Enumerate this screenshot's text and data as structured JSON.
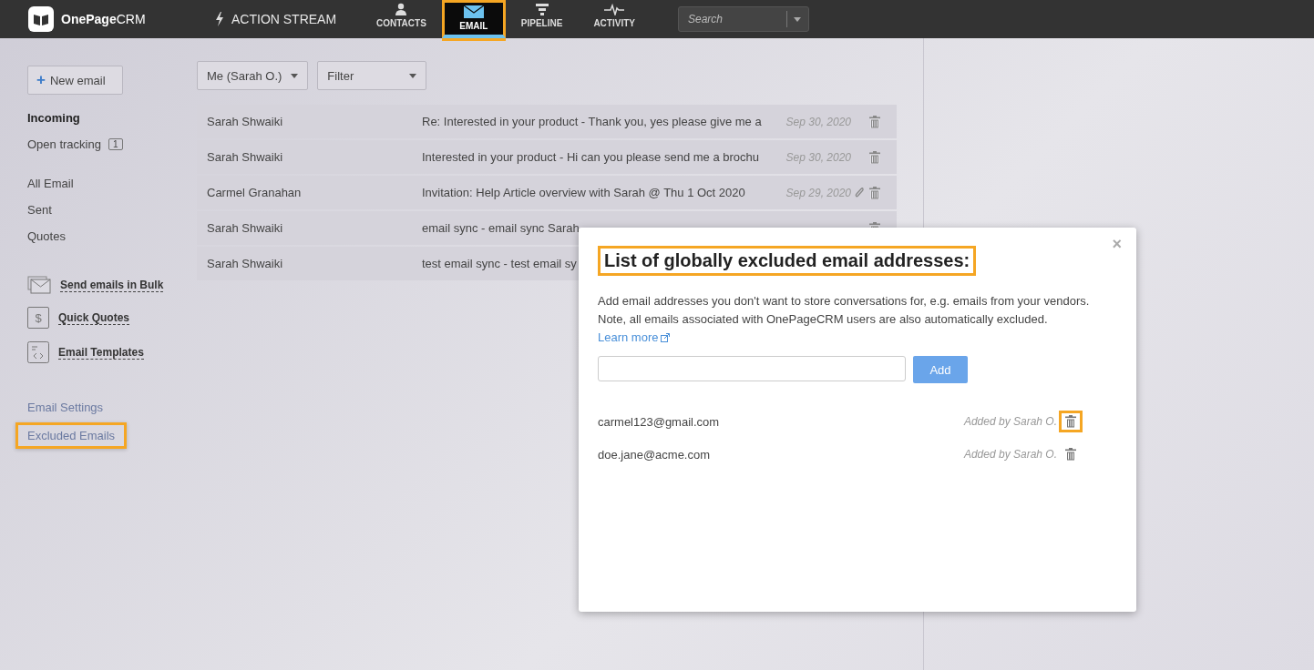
{
  "header": {
    "logo": "OnePage",
    "logo_suffix": "CRM",
    "action_stream": "ACTION STREAM",
    "nav": [
      {
        "label": "CONTACTS",
        "selected": false,
        "highlighted": false
      },
      {
        "label": "EMAIL",
        "selected": true,
        "highlighted": true
      },
      {
        "label": "PIPELINE",
        "selected": false,
        "highlighted": false
      },
      {
        "label": "ACTIVITY",
        "selected": false,
        "highlighted": false
      }
    ],
    "search": {
      "placeholder": "Search"
    }
  },
  "sidebar": {
    "new_email_icon": "+",
    "new_email": "New email",
    "folders": [
      {
        "label": "Incoming",
        "selected": true
      },
      {
        "label": "Open tracking",
        "selected": false,
        "count": "1"
      }
    ],
    "mail_folders": [
      {
        "label": "All Email",
        "selected": false
      },
      {
        "label": "Sent",
        "selected": false
      },
      {
        "label": "Quotes",
        "selected": false
      }
    ],
    "tools": [
      {
        "label": "Send emails in Bulk"
      },
      {
        "label": "Quick Quotes",
        "symbol": "$"
      },
      {
        "label": "Email Templates"
      }
    ],
    "links": [
      {
        "label": "Email Settings",
        "highlighted": false
      },
      {
        "label": "Excluded Emails",
        "highlighted": true
      }
    ]
  },
  "filters": [
    {
      "label": "Me (Sarah O.)"
    },
    {
      "label": "Filter"
    }
  ],
  "emails": [
    {
      "sender": "Sarah Shwaiki",
      "subject": "Re: Interested in your product - Thank you, yes please give me a",
      "date": "Sep 30, 2020",
      "attachment": false
    },
    {
      "sender": "Sarah Shwaiki",
      "subject": "Interested in your product - Hi can you please send me a brochu",
      "date": "Sep 30, 2020",
      "attachment": false
    },
    {
      "sender": "Carmel Granahan",
      "subject": "Invitation: Help Article overview with Sarah @ Thu 1 Oct 2020",
      "date": "Sep 29, 2020",
      "attachment": true
    },
    {
      "sender": "Sarah Shwaiki",
      "subject": "email sync - email sync Sarah"
    },
    {
      "sender": "Sarah Shwaiki",
      "subject": "test email sync - test email sy"
    }
  ],
  "modal": {
    "title": "List of globally excluded email addresses:",
    "title_highlighted": true,
    "close": "×",
    "description": "Add email addresses you don't want to store conversations for, e.g. emails from your vendors. Note, all emails associated with OnePageCRM users are also automatically excluded.",
    "learn_more": "Learn more",
    "add_button": "Add",
    "entries": [
      {
        "email": "carmel123@gmail.com",
        "added_by": "Added by Sarah O.",
        "trash_highlighted": true
      },
      {
        "email": "doe.jane@acme.com",
        "added_by": "Added by Sarah O.",
        "trash_highlighted": false
      }
    ]
  }
}
